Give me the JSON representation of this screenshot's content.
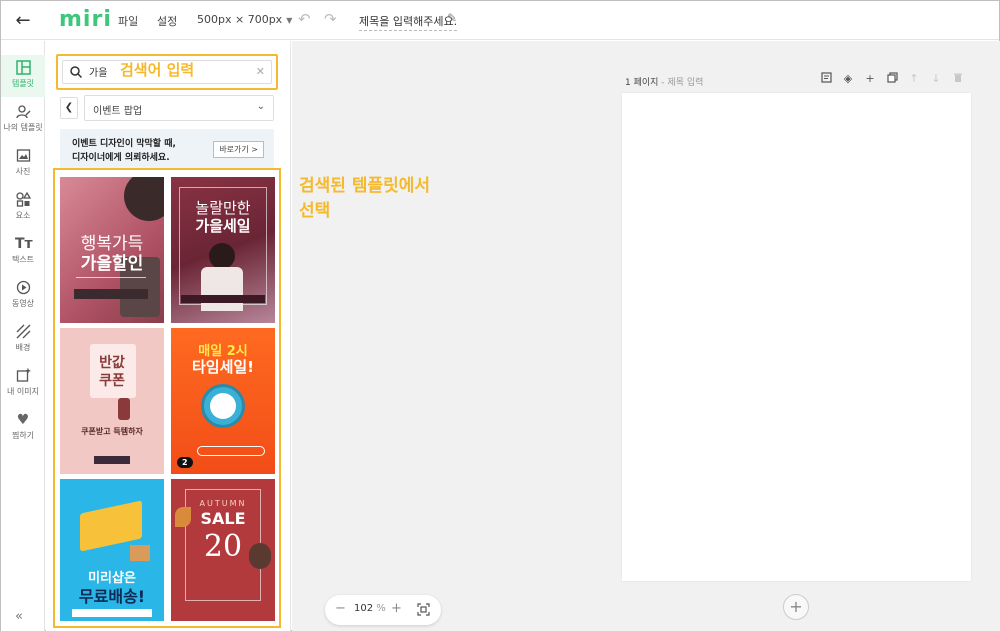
{
  "topbar": {
    "logo": "miri",
    "menu_file": "파일",
    "menu_settings": "설정",
    "size": "500px × 700px",
    "title_placeholder": "제목을 입력해주세요."
  },
  "rail": {
    "items": [
      {
        "label": "템플릿",
        "icon": "layout-icon"
      },
      {
        "label": "나의 템플릿",
        "icon": "user-edit-icon"
      },
      {
        "label": "사진",
        "icon": "image-icon"
      },
      {
        "label": "요소",
        "icon": "shapes-icon"
      },
      {
        "label": "텍스트",
        "icon": "text-icon"
      },
      {
        "label": "동영상",
        "icon": "play-icon"
      },
      {
        "label": "배경",
        "icon": "pattern-icon"
      },
      {
        "label": "내 이미지",
        "icon": "add-image-icon"
      },
      {
        "label": "찜하기",
        "icon": "heart-icon"
      }
    ],
    "collapse": "«"
  },
  "panel": {
    "search_value": "가을",
    "annotation_search": "검색어 입력",
    "category": "이벤트 팝업",
    "banner_line1": "이벤트 디자인이 막막할 때,",
    "banner_line2": "디자이너에게 의뢰하세요.",
    "banner_button": "바로가기 >",
    "templates": [
      {
        "line1": "행복가득",
        "line2": "가을할인",
        "bg": "#c06a78"
      },
      {
        "line1": "놀랄만한",
        "line2": "가을세일",
        "bg": "#7a2d3c"
      },
      {
        "line1": "반값",
        "line2": "쿠폰",
        "sub": "쿠폰받고 득템하자",
        "bg": "#f1c7c3"
      },
      {
        "line1": "매일 2시",
        "line2": "타임세일!",
        "badge": "2",
        "bg": "#fa5a1c"
      },
      {
        "line1": "미리샵은",
        "line2": "무료배송!",
        "bg": "#2ab6e6"
      },
      {
        "line1": "AUTUMN",
        "line2": "SALE",
        "big": "20",
        "bg": "#b23a3c"
      }
    ]
  },
  "annotation_results": [
    "검색된 템플릿에서",
    "선택"
  ],
  "canvas": {
    "page_label": "1 페이지",
    "page_sub": " - 제목 입력",
    "zoom_value": "102",
    "zoom_unit": " %"
  },
  "colors": {
    "brand": "#3cc77a",
    "annotation": "#f5b92d"
  }
}
